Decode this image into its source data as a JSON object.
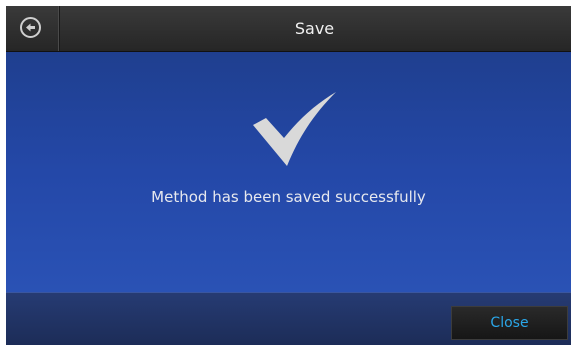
{
  "header": {
    "title": "Save",
    "back_icon": "arrow-left-circle-icon"
  },
  "main": {
    "icon": "checkmark-icon",
    "message": "Method has been saved successfully"
  },
  "footer": {
    "close_label": "Close"
  },
  "colors": {
    "accent": "#2aa6e8",
    "background_blue": "#2448a8",
    "checkmark": "#d9d9d9"
  }
}
